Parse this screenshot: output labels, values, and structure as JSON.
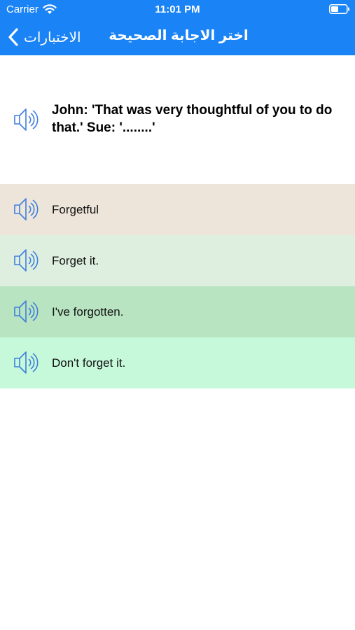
{
  "status_bar": {
    "carrier": "Carrier",
    "time": "11:01 PM",
    "wifi_icon": "wifi-icon",
    "battery_icon": "battery-icon"
  },
  "nav": {
    "back_label": "الاختبارات",
    "back_icon": "chevron-left-icon",
    "title": "اختر الاجابة الصحيحة",
    "bar_color": "#1a83f5"
  },
  "question": {
    "text": "John: 'That was very thoughtful of you to do that.' Sue: '........'",
    "icon": "speaker-icon"
  },
  "options": [
    {
      "text": "Forgetful",
      "color": "#ede5da"
    },
    {
      "text": "Forget it.",
      "color": "#deefe0"
    },
    {
      "text": "I've forgotten.",
      "color": "#b8e4c1"
    },
    {
      "text": "Don't forget it.",
      "color": "#c6f8da"
    }
  ],
  "speaker_icon_color": "#3f7fdc"
}
